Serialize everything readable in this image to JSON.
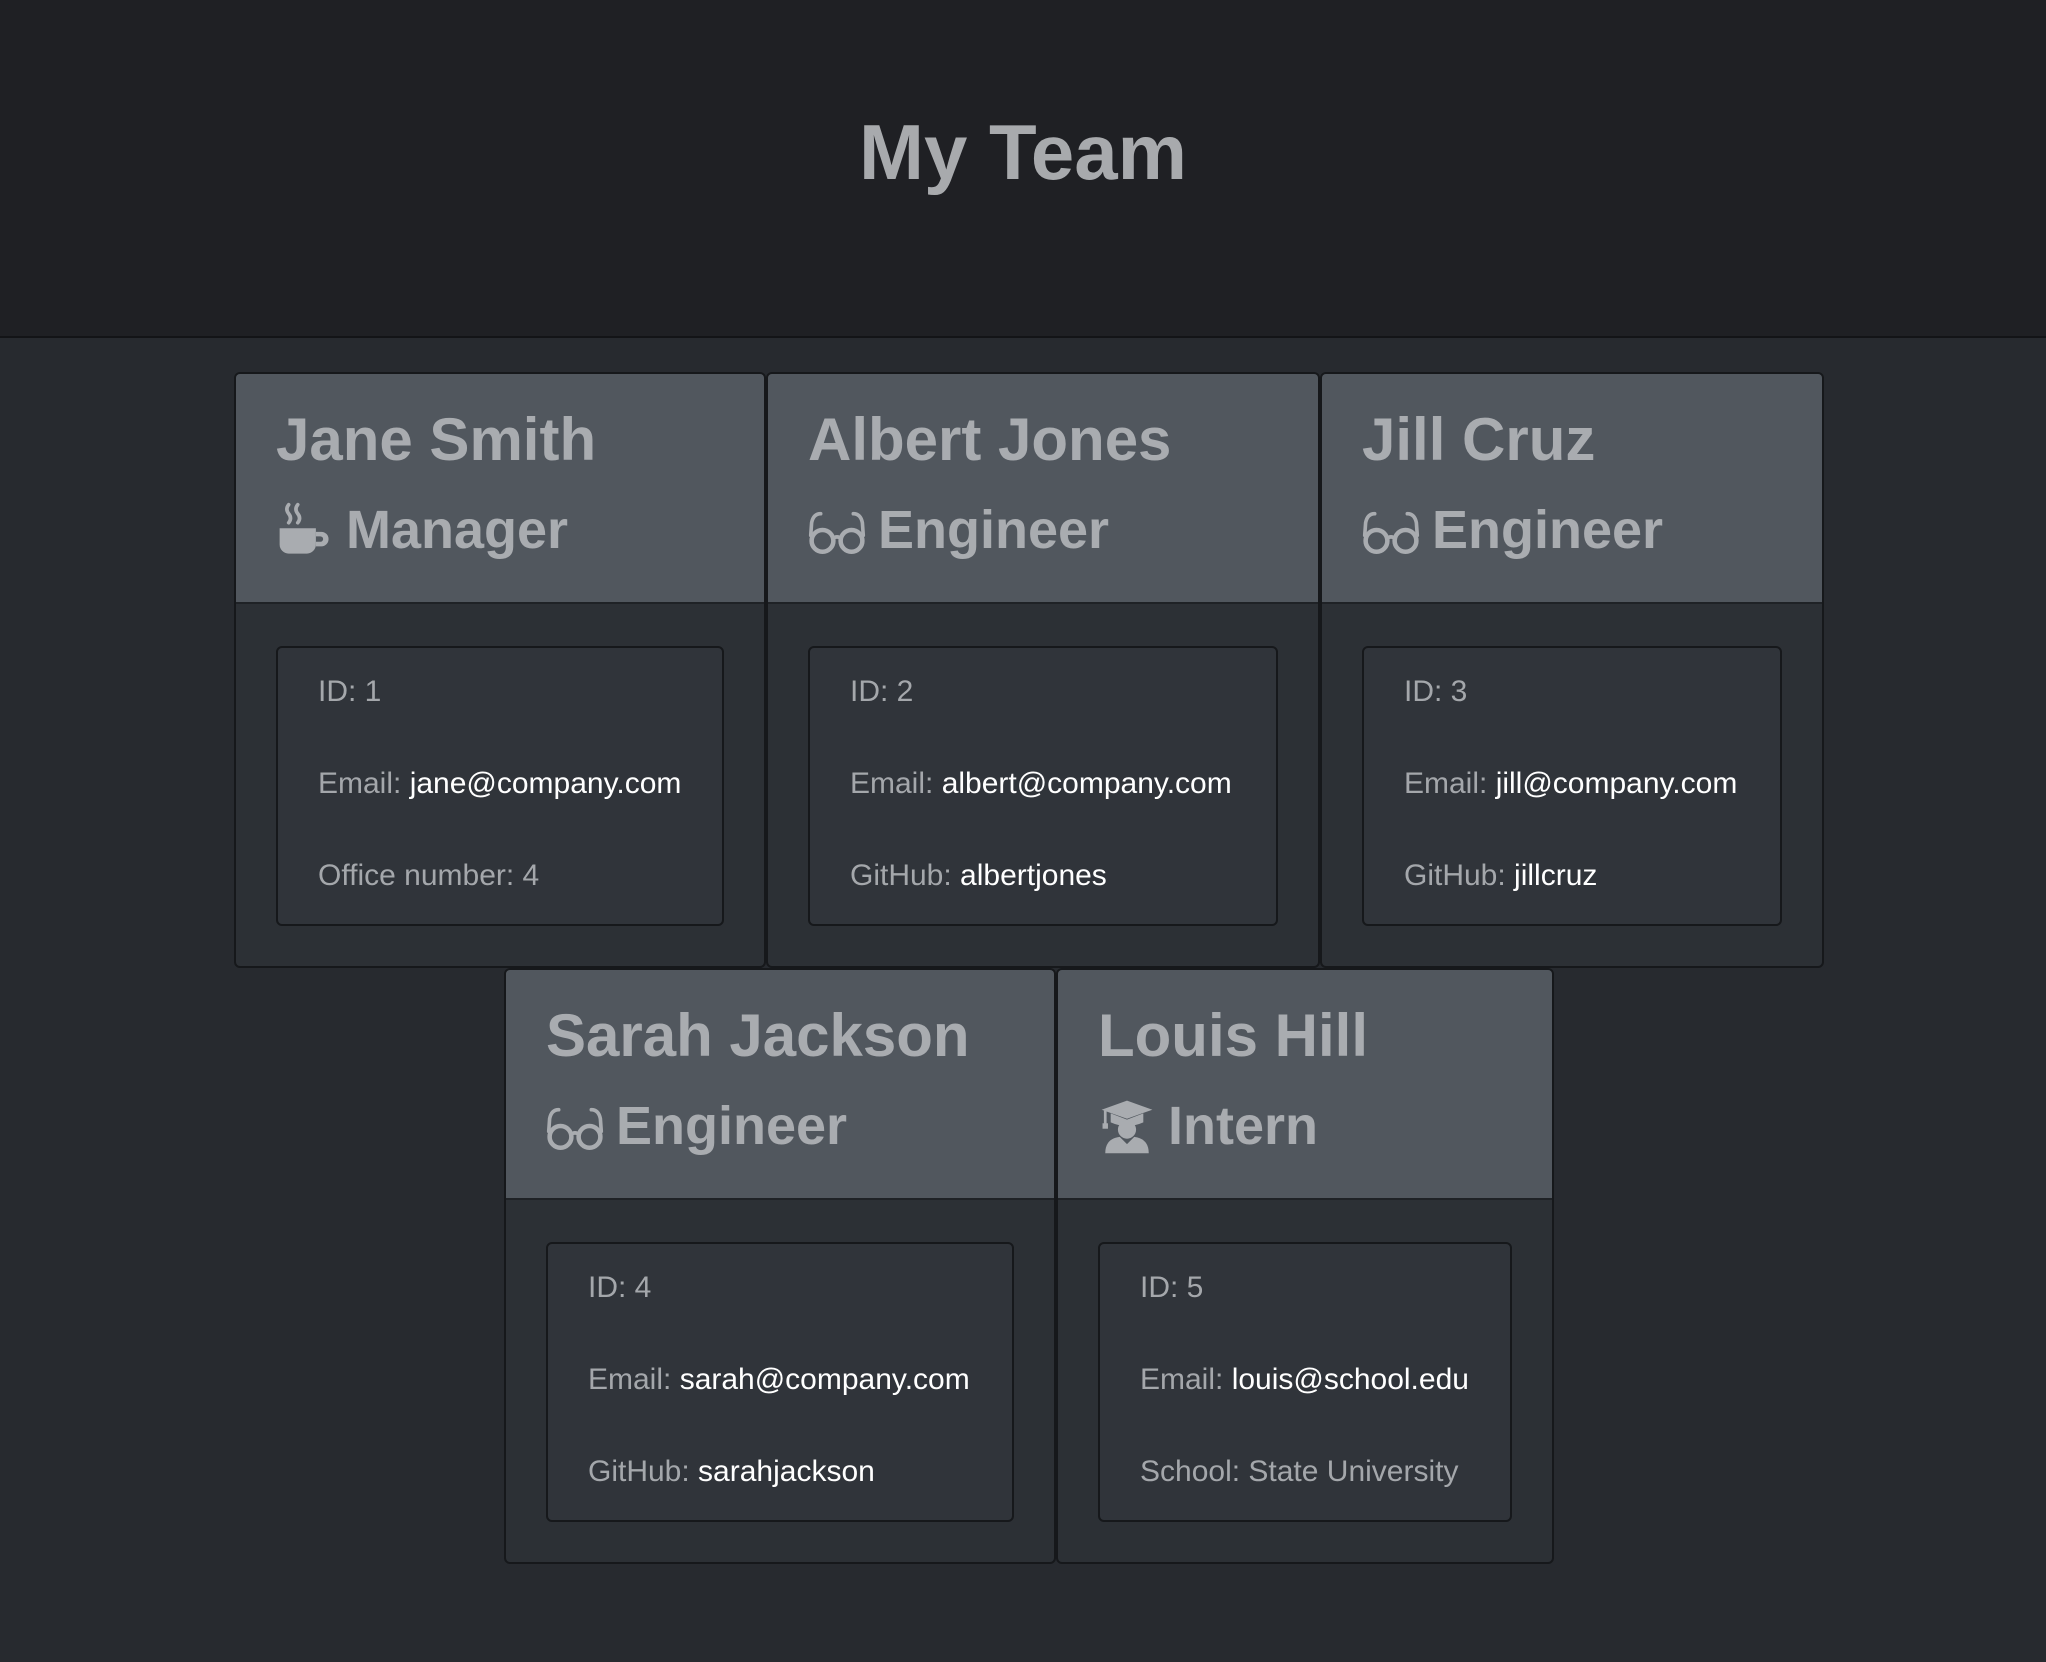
{
  "header": {
    "title": "My Team"
  },
  "colors": {
    "header_bg": "#51575e",
    "page_bg": "#272a2f",
    "link_text": "#ffffff"
  },
  "employees": [
    {
      "name": "Jane Smith",
      "role": "Manager",
      "icon": "coffee-icon",
      "id_label": "ID: ",
      "id": "1",
      "email_label": "Email: ",
      "email": "jane@company.com",
      "extra_label": "Office number: ",
      "extra_value": "4"
    },
    {
      "name": "Albert Jones",
      "role": "Engineer",
      "icon": "glasses-icon",
      "id_label": "ID: ",
      "id": "2",
      "email_label": "Email: ",
      "email": "albert@company.com",
      "extra_label": "GitHub: ",
      "extra_value": "albertjones"
    },
    {
      "name": "Jill Cruz",
      "role": "Engineer",
      "icon": "glasses-icon",
      "id_label": "ID: ",
      "id": "3",
      "email_label": "Email: ",
      "email": "jill@company.com",
      "extra_label": "GitHub: ",
      "extra_value": "jillcruz"
    },
    {
      "name": "Sarah Jackson",
      "role": "Engineer",
      "icon": "glasses-icon",
      "id_label": "ID: ",
      "id": "4",
      "email_label": "Email: ",
      "email": "sarah@company.com",
      "extra_label": "GitHub: ",
      "extra_value": "sarahjackson"
    },
    {
      "name": "Louis Hill",
      "role": "Intern",
      "icon": "graduate-icon",
      "id_label": "ID: ",
      "id": "5",
      "email_label": "Email: ",
      "email": "louis@school.edu",
      "extra_label": "School: ",
      "extra_value": "State University"
    }
  ]
}
